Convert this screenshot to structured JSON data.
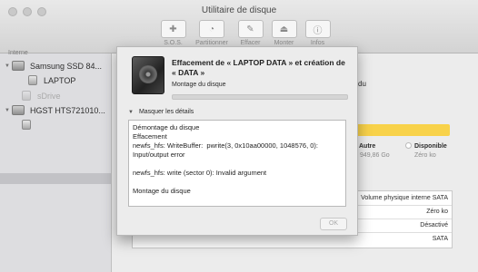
{
  "window": {
    "title": "Utilitaire de disque"
  },
  "toolbar": {
    "items": [
      {
        "label": "S.O.S.",
        "icon": "stethoscope-icon",
        "glyph": "✚"
      },
      {
        "label": "Partitionner",
        "icon": "partition-icon",
        "glyph": "◔"
      },
      {
        "label": "Effacer",
        "icon": "erase-icon",
        "glyph": "✎"
      },
      {
        "label": "Monter",
        "icon": "mount-icon",
        "glyph": "⏏"
      },
      {
        "label": "Infos",
        "icon": "info-icon",
        "glyph": "ⓘ"
      }
    ]
  },
  "sidebar": {
    "section_label": "Interne",
    "items": [
      {
        "label": "Samsung SSD 84...",
        "type": "disk"
      },
      {
        "label": "LAPTOP",
        "type": "volume"
      },
      {
        "label": "sDrive",
        "type": "volume-dimmed"
      },
      {
        "label": "HGST HTS721010...",
        "type": "disk"
      }
    ]
  },
  "background": {
    "right_partial": "du",
    "legend": [
      {
        "label": "Autre",
        "value": "949,86 Go",
        "color": "#f8d24a"
      },
      {
        "label": "Disponible",
        "value": "Zéro ko",
        "color": "#ffffff"
      }
    ],
    "info_rows": [
      "Volume physique interne SATA",
      "Zéro ko",
      "Désactivé",
      "SATA"
    ]
  },
  "sheet": {
    "title": "Effacement de « LAPTOP DATA » et création de « DATA »",
    "status": "Montage du disque",
    "progress_fraction": 0,
    "details_label": "Masquer les détails",
    "log_lines": [
      "Démontage du disque",
      "Effacement",
      "newfs_hfs: WriteBuffer:  pwrite(3, 0x10aa00000, 1048576, 0): Input/output error",
      "",
      "newfs_hfs: write (sector 0): Invalid argument",
      "",
      "Montage du disque"
    ],
    "ok_label": "OK"
  },
  "colors": {
    "accent": "#3a86ff",
    "yellow_bar": "#f8d24a"
  }
}
